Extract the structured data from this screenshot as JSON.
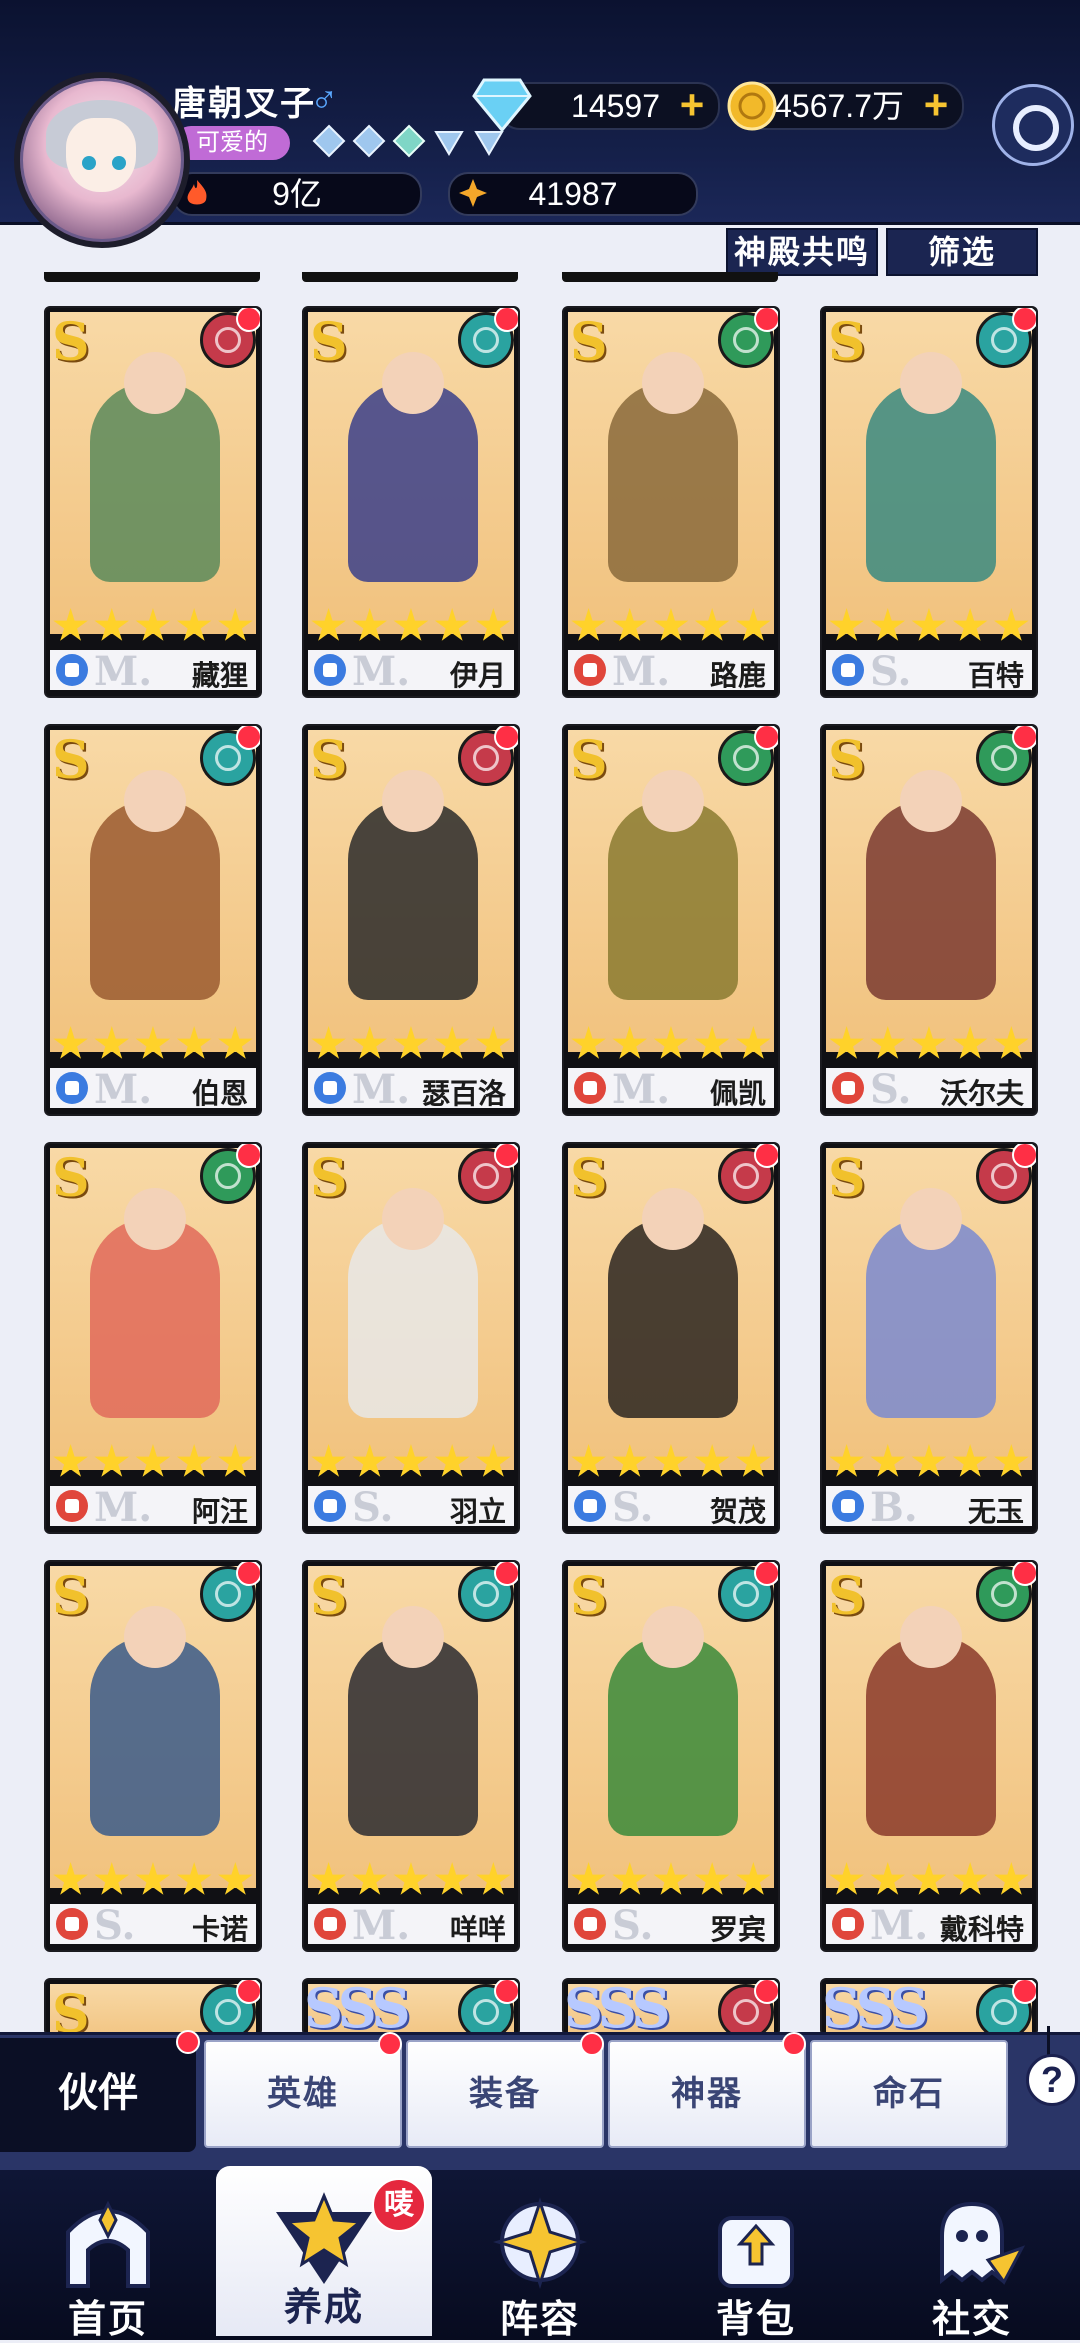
{
  "player": {
    "name": "唐朝叉子",
    "gender_symbol": "♂",
    "title": "可爱的",
    "stars_count": 5
  },
  "resources": {
    "diamonds": "14597",
    "gold": "4567.7万",
    "power": "9亿",
    "energy": "41987"
  },
  "filters": {
    "resonance": "神殿共鸣",
    "filter": "筛选"
  },
  "heroes": [
    {
      "name": "藏狸",
      "rank": "S",
      "tier": "M.",
      "stars": 5,
      "element": "#c53a4a",
      "cls": "#3b7be0",
      "palette": "#5a8a5a"
    },
    {
      "name": "伊月",
      "rank": "S",
      "tier": "M.",
      "stars": 5,
      "element": "#2aa3a0",
      "cls": "#3b7be0",
      "palette": "#3b3f8a"
    },
    {
      "name": "路鹿",
      "rank": "S",
      "tier": "M.",
      "stars": 5,
      "element": "#2f9a5a",
      "cls": "#e0463b",
      "palette": "#8a6a3b"
    },
    {
      "name": "百特",
      "rank": "S",
      "tier": "S.",
      "stars": 5,
      "element": "#2aa3a0",
      "cls": "#3b7be0",
      "palette": "#3a8a80"
    },
    {
      "name": "伯恩",
      "rank": "S",
      "tier": "M.",
      "stars": 5,
      "element": "#2aa3a0",
      "cls": "#3b7be0",
      "palette": "#9a5a30"
    },
    {
      "name": "瑟百洛",
      "rank": "S",
      "tier": "M.",
      "stars": 5,
      "element": "#c53a4a",
      "cls": "#3b7be0",
      "palette": "#2a2a2a"
    },
    {
      "name": "佩凯",
      "rank": "S",
      "tier": "M.",
      "stars": 5,
      "element": "#2f9a5a",
      "cls": "#e0463b",
      "palette": "#8a7a30"
    },
    {
      "name": "沃尔夫",
      "rank": "S",
      "tier": "S.",
      "stars": 5,
      "element": "#2f9a5a",
      "cls": "#e0463b",
      "palette": "#7a3a30"
    },
    {
      "name": "阿汪",
      "rank": "S",
      "tier": "M.",
      "stars": 5,
      "element": "#2f9a5a",
      "cls": "#e0463b",
      "palette": "#e06a5a"
    },
    {
      "name": "羽立",
      "rank": "S",
      "tier": "S.",
      "stars": 5,
      "element": "#c53a4a",
      "cls": "#3b7be0",
      "palette": "#e8e8e8"
    },
    {
      "name": "贺茂",
      "rank": "S",
      "tier": "S.",
      "stars": 5,
      "element": "#c53a4a",
      "cls": "#3b7be0",
      "palette": "#2a2520"
    },
    {
      "name": "无玉",
      "rank": "S",
      "tier": "B.",
      "stars": 5,
      "element": "#c53a4a",
      "cls": "#3b7be0",
      "palette": "#7a8ad0"
    },
    {
      "name": "卡诺",
      "rank": "S",
      "tier": "S.",
      "stars": 5,
      "element": "#2aa3a0",
      "cls": "#e0463b",
      "palette": "#3a5a8a"
    },
    {
      "name": "咩咩",
      "rank": "S",
      "tier": "M.",
      "stars": 5,
      "element": "#2aa3a0",
      "cls": "#e0463b",
      "palette": "#2a2a30"
    },
    {
      "name": "罗宾",
      "rank": "S",
      "tier": "S.",
      "stars": 5,
      "element": "#2aa3a0",
      "cls": "#e0463b",
      "palette": "#3a8a3a"
    },
    {
      "name": "戴科特",
      "rank": "S",
      "tier": "M.",
      "stars": 5,
      "element": "#2f9a5a",
      "cls": "#e0463b",
      "palette": "#8a3a2a"
    }
  ],
  "partial_bottom_ranks": [
    "S",
    "SSS",
    "SSS",
    "SSS"
  ],
  "tabs": {
    "active": "伙伴",
    "items": [
      "英雄",
      "装备",
      "神器",
      "命石"
    ],
    "help": "?"
  },
  "nav": {
    "items": [
      {
        "label": "首页",
        "icon": "temple-icon"
      },
      {
        "label": "养成",
        "icon": "star-triangle-icon",
        "badge": "唛"
      },
      {
        "label": "阵容",
        "icon": "compass-star-icon"
      },
      {
        "label": "背包",
        "icon": "bag-icon"
      },
      {
        "label": "社交",
        "icon": "ghost-plane-icon"
      }
    ],
    "active_index": 1
  }
}
